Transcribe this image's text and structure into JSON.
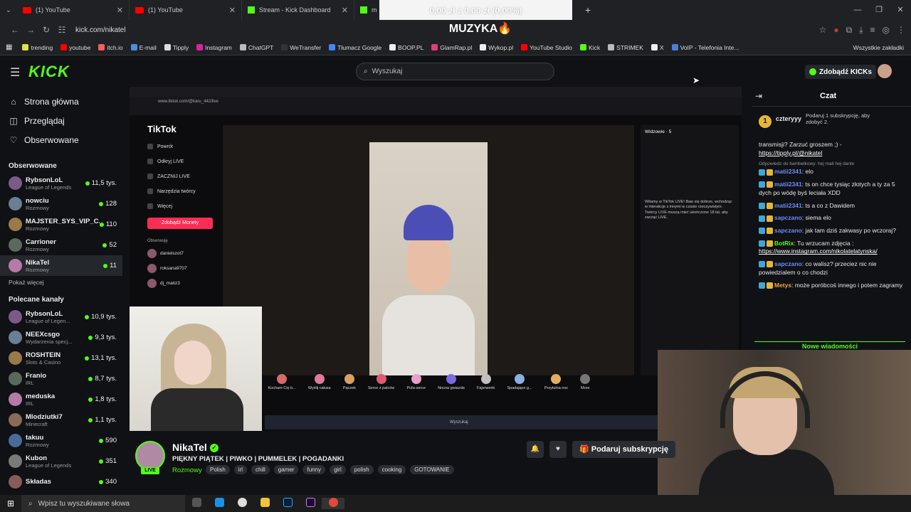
{
  "browser": {
    "tabs": [
      {
        "title": "(1) YouTube",
        "icon": "youtube"
      },
      {
        "title": "(1) YouTube",
        "icon": "youtube"
      },
      {
        "title": "Stream - Kick Dashboard",
        "icon": "kick"
      },
      {
        "title": "mi",
        "icon": "kick"
      }
    ],
    "url": "kick.com/nikatel",
    "bookmarks": [
      "trending",
      "youtube",
      "itch.io",
      "E-mail",
      "Tipply",
      "Instagram",
      "ChatGPT",
      "WeTransfer",
      "Tłumacz Google",
      "BOOP.PL",
      "GlamRap.pl",
      "Wykop.pl",
      "YouTube Studio",
      "Kick",
      "STRIMEK",
      "X",
      "VoIP - Telefonia Inte..."
    ],
    "bookmarks_folder": "Wszystkie zakładki"
  },
  "overlay": {
    "donation_bar": "0,00 zł z 0,00 zł (0,00%)",
    "music": "MUZYKA🔥"
  },
  "kick": {
    "search_placeholder": "Wyszukaj",
    "get_kicks": "Zdobądź KICKs",
    "nav": [
      {
        "label": "Strona główna",
        "icon": "home-icon"
      },
      {
        "label": "Przeglądaj",
        "icon": "browse-icon"
      },
      {
        "label": "Obserwowane",
        "icon": "heart-icon"
      }
    ],
    "followed_title": "Obserwowane",
    "followed": [
      {
        "name": "RybsonLoL",
        "category": "League of Legends",
        "viewers": "11,5 tys."
      },
      {
        "name": "nowciu",
        "category": "Rozmowy",
        "viewers": "128"
      },
      {
        "name": "MAJSTER_SYS_VIP_C...",
        "category": "Rozmowy",
        "viewers": "110"
      },
      {
        "name": "Carrioner",
        "category": "Rozmowy",
        "viewers": "52"
      },
      {
        "name": "NikaTel",
        "category": "Rozmowy",
        "viewers": "11"
      }
    ],
    "show_more": "Pokaż więcej",
    "recommended_title": "Polecane kanały",
    "recommended": [
      {
        "name": "RybsonLoL",
        "category": "League of Legen...",
        "viewers": "10,9 tys."
      },
      {
        "name": "NEEXcsgo",
        "category": "Wydarzenia specj...",
        "viewers": "9,3 tys."
      },
      {
        "name": "ROSHTEIN",
        "category": "Slots & Casino",
        "viewers": "13,1 tys."
      },
      {
        "name": "Franio",
        "category": "IRL",
        "viewers": "8,7 tys."
      },
      {
        "name": "meduska",
        "category": "IRL",
        "viewers": "1,8 tys."
      },
      {
        "name": "Mlodziutki7",
        "category": "Minecraft",
        "viewers": "1,1 tys."
      },
      {
        "name": "takuu",
        "category": "Rozmowy",
        "viewers": "590"
      },
      {
        "name": "Kubon",
        "category": "League of Legends",
        "viewers": "351"
      },
      {
        "name": "Składas",
        "category": "",
        "viewers": "340"
      }
    ],
    "chat_title": "Czat",
    "pinned": {
      "user": "czteryyy",
      "coin": "1",
      "text": "Podaruj 1 subskrypcję, aby zdobyć 2."
    },
    "messages": [
      {
        "user": "",
        "text": "transmisji? Zarzuć groszem ;) -",
        "link": "https://tipply.pl/@nikatel"
      },
      {
        "reply": "Odpowiedz do bambelkowy: hej mati hej dante",
        "user": "matii2341",
        "text": "elo"
      },
      {
        "user": "matii2341",
        "text": "ts on chce tysiąc złotych a ty za 5 dych po wódę byś leciała XDD"
      },
      {
        "user": "matii2341",
        "text": "ts a co z Dawidem"
      },
      {
        "user": "sapczano",
        "text": "siema elo"
      },
      {
        "user": "sapczano",
        "text": "jak tam dziś zakwasy po wczoraj?"
      },
      {
        "user": "BotRix",
        "text": "Tu wrzucam zdjęcia :",
        "link": "https://www.instagram.com/nikolatelatynska/"
      },
      {
        "user": "sapczano",
        "text": "co walisz? przeciez nic nie powiedzialem o co chodzi"
      },
      {
        "user": "Metys",
        "text": "może poróbcoś innego i potem zagramy"
      }
    ],
    "new_messages": "Nowe wiadomości",
    "streamer": {
      "name": "NikaTel",
      "live": "LIVE",
      "title": "PIĘKNY PIĄTEK | PIWKO | PUMMELEK | POGADANKI",
      "category": "Rozmowy",
      "tags": [
        "Polish",
        "irl",
        "chill",
        "gamer",
        "funny",
        "girl",
        "polish",
        "cooking",
        "GOTOWANIE"
      ],
      "gift_sub": "Podaruj subskrypcję"
    }
  },
  "tiktok": {
    "logo": "TikTok",
    "menu": [
      "Powrót",
      "Odkryj LIVE",
      "ZACZNIJ LIVE",
      "Narzędzia twórcy",
      "Więcej"
    ],
    "coins_button": "Zdobądź Monety",
    "following": "Obserwuję",
    "users": [
      "danielszot7",
      "roksana9707",
      "dj_matiz3"
    ],
    "viewers_title": "Widzowie · 5",
    "url": "www.tiktok.com/@karu_442/live",
    "gifts": [
      "Kocham Cię b...",
      "Wyślij całusa",
      "Pączek",
      "Serce z palców",
      "Pufa-serce",
      "Nocna gwiazda",
      "Fajerwerki",
      "Spadające g...",
      "Przytulna noc",
      "More"
    ],
    "info": "Witamy w TikTok LIVE! Baw się dobrze, wchodząc w interakcje z innymi w czasie rzeczywistym. Twórcy LIVE muszą mieć ukończone 18 lat, aby zacząć LIVE.",
    "taskbar_search": "Wyszukaj"
  },
  "taskbar": {
    "search": "Wpisz tu wyszukiwane słowa"
  }
}
